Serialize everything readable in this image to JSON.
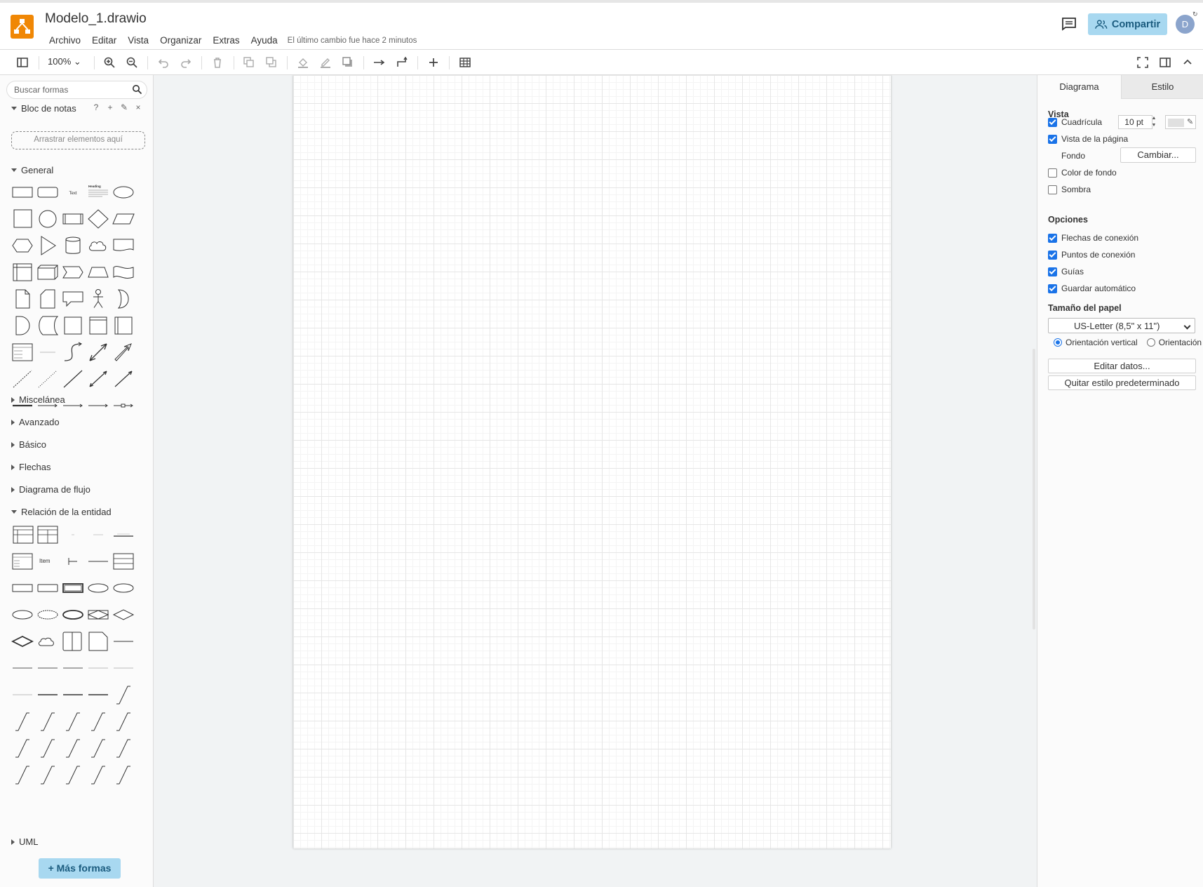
{
  "header": {
    "file_title": "Modelo_1.drawio",
    "menu": [
      "Archivo",
      "Editar",
      "Vista",
      "Organizar",
      "Extras",
      "Ayuda"
    ],
    "last_change": "El último cambio fue hace 2 minutos",
    "share_label": "Compartir",
    "avatar_letter": "D",
    "brand_color": "#f08705"
  },
  "toolbar": {
    "zoom": "100%"
  },
  "left": {
    "search_placeholder": "Buscar formas",
    "notes_title": "Bloc de notas",
    "dropzone": "Arrastrar elementos aquí",
    "general_title": "General",
    "collapsed_sections": [
      "Miscelánea",
      "Avanzado",
      "Básico",
      "Flechas",
      "Diagrama de flujo"
    ],
    "er_title": "Relación de la entidad",
    "uml_title": "UML",
    "more_shapes": "+ Más formas",
    "shape_text_label": "Text",
    "shape_heading_label": "Heading",
    "shape_item_label": "Item"
  },
  "right": {
    "tabs": [
      "Diagrama",
      "Estilo"
    ],
    "view_title": "Vista",
    "grid_label": "Cuadrícula",
    "grid_checked": true,
    "grid_size": "10 pt",
    "page_view_label": "Vista de la página",
    "page_view_checked": true,
    "background_label": "Fondo",
    "change_button": "Cambiar...",
    "bg_color_label": "Color de fondo",
    "shadow_label": "Sombra",
    "options_title": "Opciones",
    "options": [
      {
        "label": "Flechas de conexión",
        "checked": true
      },
      {
        "label": "Puntos de conexión",
        "checked": true
      },
      {
        "label": "Guías",
        "checked": true
      },
      {
        "label": "Guardar automático",
        "checked": true
      }
    ],
    "paper_title": "Tamaño del papel",
    "paper_size": "US-Letter (8,5\" x 11\")",
    "orientation_vertical": "Orientación vertical",
    "orientation_horizontal": "Orientación",
    "edit_data_button": "Editar datos...",
    "clear_style_button": "Quitar estilo predeterminado",
    "accent_color": "#1a73e8"
  }
}
